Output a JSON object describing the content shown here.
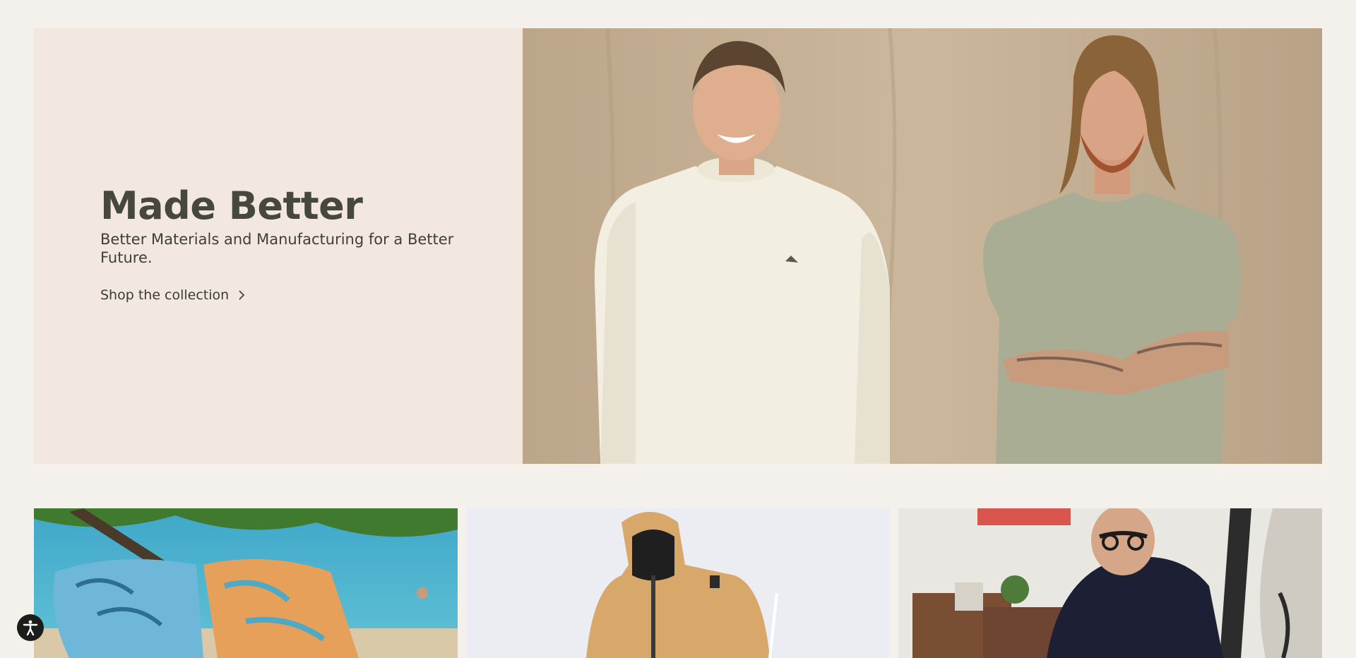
{
  "hero": {
    "title": "Made Better",
    "subtitle": "Better Materials and Manufacturing for a Better Future.",
    "cta_label": "Shop the collection",
    "colors": {
      "panel_background": "#f2e8df",
      "title_color": "#46483e",
      "photo_backdrop": "#bfa98d"
    }
  },
  "hero_photo": {
    "icon": "two-models-photo"
  },
  "tiles": [
    {
      "icon": "boardshorts-beach-photo"
    },
    {
      "icon": "snow-jacket-photo"
    },
    {
      "icon": "surfboard-shaper-photo"
    }
  ],
  "accessibility": {
    "icon": "accessibility-icon"
  }
}
